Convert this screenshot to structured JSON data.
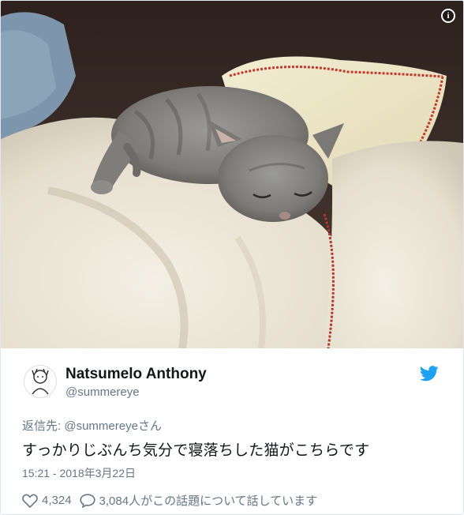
{
  "tweet": {
    "display_name": "Natsumelo Anthony",
    "handle": "@summereye",
    "reply_prefix": "返信先:",
    "reply_mention": "@summereye",
    "reply_suffix": "さん",
    "text": "すっかりじぶんち気分で寝落ちした猫がこちらです",
    "timestamp": "15:21 - 2018年3月22日",
    "like_count": "4,324",
    "discussion_text": "3,084人がこの話題について話しています"
  },
  "icons": {
    "info": "info-icon",
    "brand": "twitter-bird-icon",
    "like": "heart-icon",
    "reply": "speech-bubble-icon"
  },
  "colors": {
    "brand": "#1da1f2",
    "secondary_text": "#657786",
    "primary_text": "#14171a"
  }
}
